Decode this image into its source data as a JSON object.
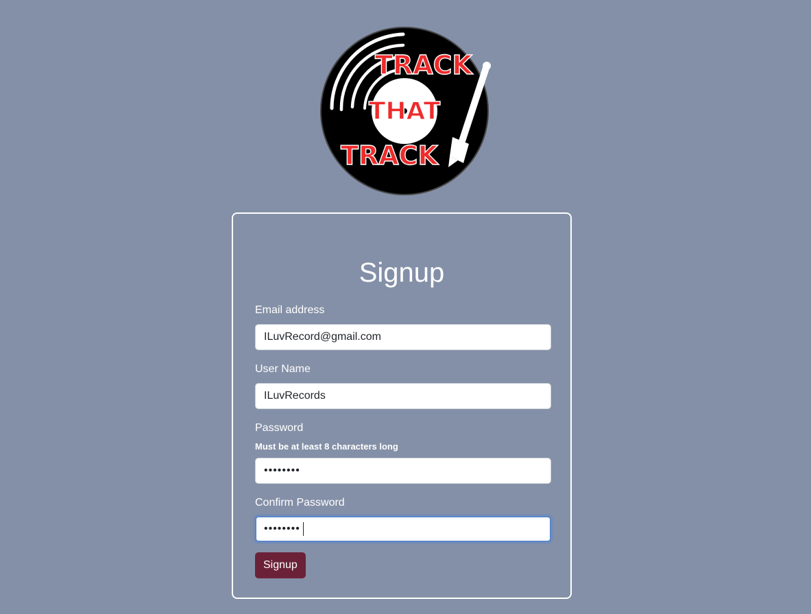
{
  "logo": {
    "line1": "TRACK",
    "line2": "THAT",
    "line3": "TRACK"
  },
  "form": {
    "title": "Signup",
    "email": {
      "label": "Email address",
      "value": "ILuvRecord@gmail.com"
    },
    "username": {
      "label": "User Name",
      "value": "ILuvRecords"
    },
    "password": {
      "label": "Password",
      "help": "Must be at least 8 characters long",
      "value": "••••••••"
    },
    "confirm_password": {
      "label": "Confirm Password",
      "value": "••••••••"
    },
    "submit_label": "Signup"
  },
  "colors": {
    "background": "#8490a7",
    "button": "#6b2238",
    "logo_text": "#ee2b2b",
    "focus_ring": "#5b86c8"
  }
}
